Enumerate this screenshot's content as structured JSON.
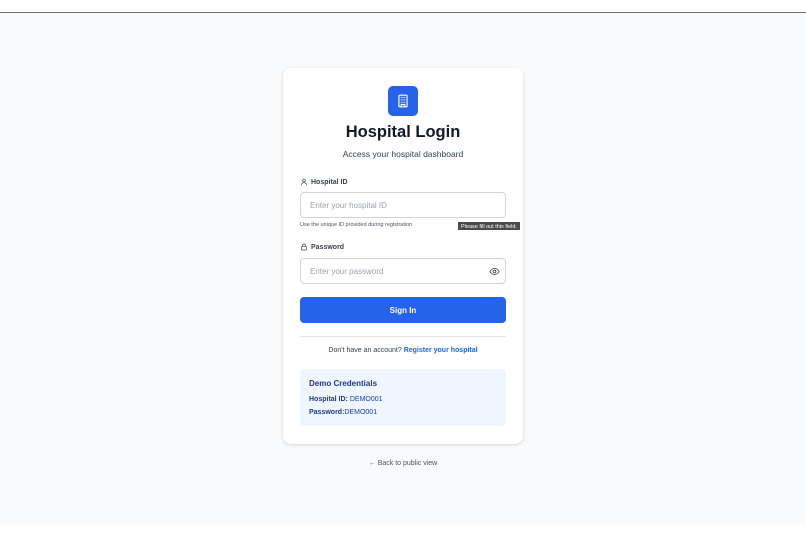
{
  "header": {
    "title": "Hospital Login",
    "subtitle": "Access your hospital dashboard",
    "logo_icon": "building-icon",
    "accent": "#2563eb"
  },
  "form": {
    "hospital_id_label": "Hospital ID",
    "hospital_id_placeholder": "Enter your hospital ID",
    "hospital_id_value": "",
    "hospital_id_hint": "Use the unique ID provided during registration",
    "validation_tooltip": "Please fill out this field.",
    "password_label": "Password",
    "password_placeholder": "Enter your password",
    "password_value": "",
    "submit_label": "Sign In"
  },
  "register": {
    "prompt": "Don't have an account?",
    "link": "Register your hospital"
  },
  "demo": {
    "title": "Demo Credentials",
    "hospital_id_label": "Hospital ID:",
    "hospital_id_value": "DEMO001",
    "password_label": "Password:",
    "password_value": "DEMO001"
  },
  "footer": {
    "back_link": "← Back to public view"
  }
}
